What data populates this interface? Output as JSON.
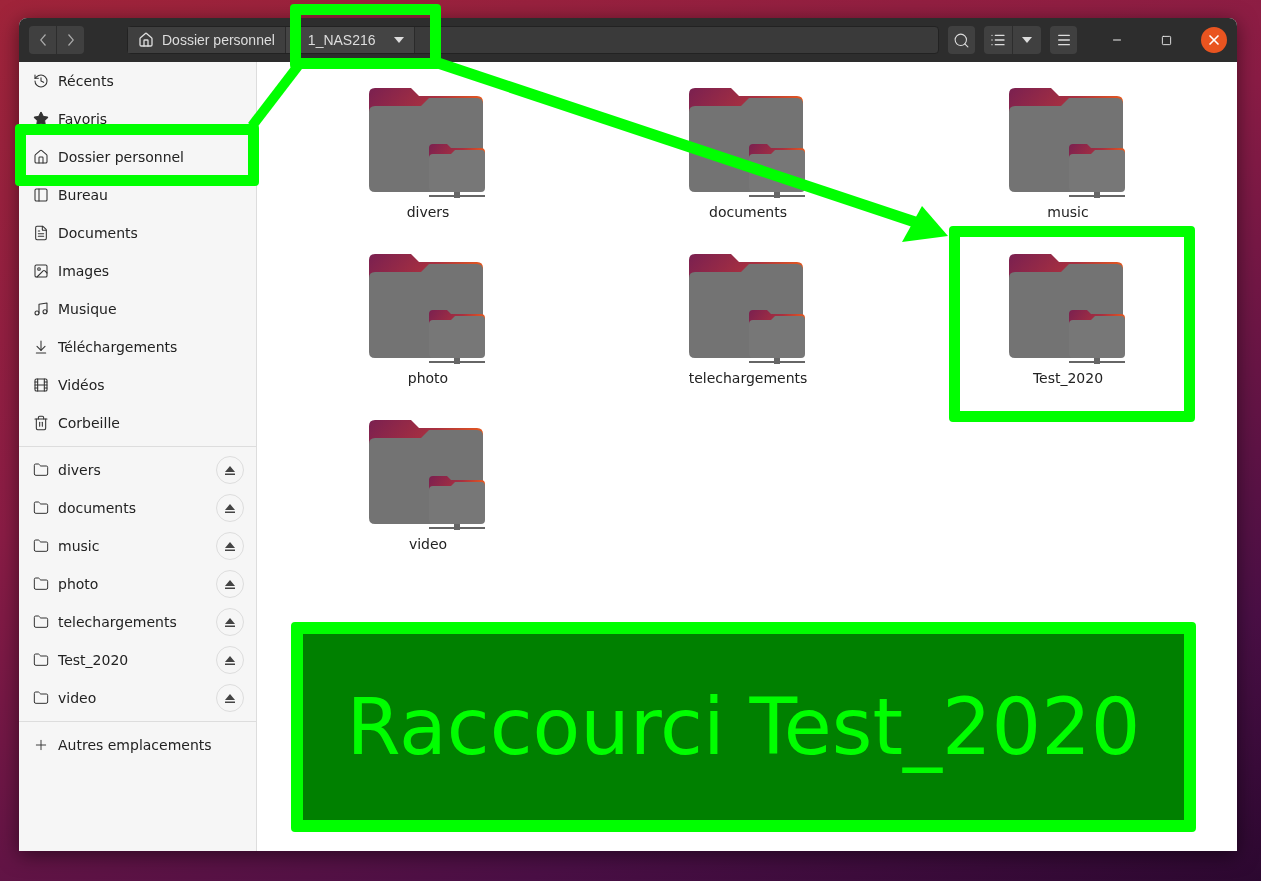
{
  "path_bar": {
    "segments": [
      {
        "label": "Dossier personnel",
        "selected": false
      },
      {
        "label": "1_NAS216",
        "selected": true
      }
    ]
  },
  "sidebar": {
    "places": [
      {
        "label": "Récents"
      },
      {
        "label": "Favoris"
      },
      {
        "label": "Dossier personnel"
      },
      {
        "label": "Bureau"
      },
      {
        "label": "Documents"
      },
      {
        "label": "Images"
      },
      {
        "label": "Musique"
      },
      {
        "label": "Téléchargements"
      },
      {
        "label": "Vidéos"
      },
      {
        "label": "Corbeille"
      }
    ],
    "mounts": [
      {
        "label": "divers"
      },
      {
        "label": "documents"
      },
      {
        "label": "music"
      },
      {
        "label": "photo"
      },
      {
        "label": "telechargements"
      },
      {
        "label": "Test_2020"
      },
      {
        "label": "video"
      }
    ],
    "other": {
      "label": "Autres emplacements"
    }
  },
  "folders": [
    {
      "name": "divers"
    },
    {
      "name": "documents"
    },
    {
      "name": "music"
    },
    {
      "name": "photo"
    },
    {
      "name": "telechargements"
    },
    {
      "name": "Test_2020"
    },
    {
      "name": "video"
    }
  ],
  "annotation": {
    "text": "Raccourci Test_2020"
  }
}
